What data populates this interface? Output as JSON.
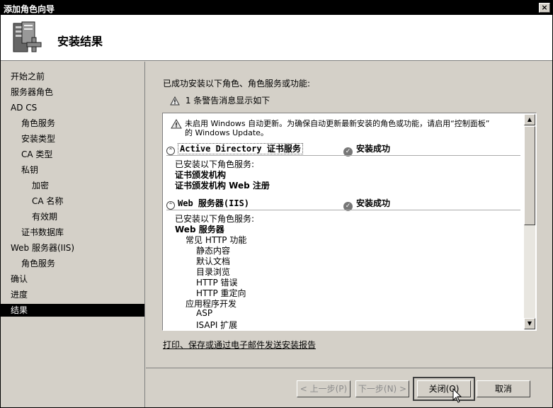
{
  "window": {
    "title": "添加角色向导",
    "close_glyph": "×"
  },
  "header": {
    "title": "安装结果",
    "icon": "server-install-icon"
  },
  "sidebar": {
    "items": [
      {
        "label": "开始之前",
        "level": 0
      },
      {
        "label": "服务器角色",
        "level": 0
      },
      {
        "label": "AD CS",
        "level": 0
      },
      {
        "label": "角色服务",
        "level": 1
      },
      {
        "label": "安装类型",
        "level": 1
      },
      {
        "label": "CA 类型",
        "level": 1
      },
      {
        "label": "私钥",
        "level": 1
      },
      {
        "label": "加密",
        "level": 2
      },
      {
        "label": "CA 名称",
        "level": 2
      },
      {
        "label": "有效期",
        "level": 2
      },
      {
        "label": "证书数据库",
        "level": 1
      },
      {
        "label": "Web 服务器(IIS)",
        "level": 0
      },
      {
        "label": "角色服务",
        "level": 1
      },
      {
        "label": "确认",
        "level": 0
      },
      {
        "label": "进度",
        "level": 0
      },
      {
        "label": "结果",
        "level": 0,
        "active": true
      }
    ]
  },
  "main": {
    "intro": "已成功安装以下角色、角色服务或功能:",
    "warning_summary": "1 条警告消息显示如下",
    "results": {
      "warning_line1": "未启用 Windows 自动更新。为确保自动更新最新安装的角色或功能，请启用“控制面板”",
      "warning_line2": "的 Windows Update。",
      "sections": [
        {
          "title": "Active Directory 证书服务",
          "status": "安装成功",
          "installed_label": "已安装以下角色服务:",
          "items": [
            "证书颁发机构",
            "证书颁发机构 Web 注册"
          ]
        },
        {
          "title": "Web 服务器(IIS)",
          "status": "安装成功",
          "installed_label": "已安装以下角色服务:",
          "items": [
            "Web 服务器",
            "常见 HTTP 功能",
            "静态内容",
            "默认文档",
            "目录浏览",
            "HTTP 错误",
            "HTTP 重定向",
            "应用程序开发",
            "ASP",
            "ISAPI 扩展"
          ]
        }
      ]
    },
    "report_link": "打印、保存或通过电子邮件发送安装报告"
  },
  "footer": {
    "prev": "< 上一步(P)",
    "next": "下一步(N) >",
    "close": "关闭(O)",
    "cancel": "取消"
  },
  "colors": {
    "active_bg": "#000000",
    "dialog_bg": "#d4d0c8"
  }
}
